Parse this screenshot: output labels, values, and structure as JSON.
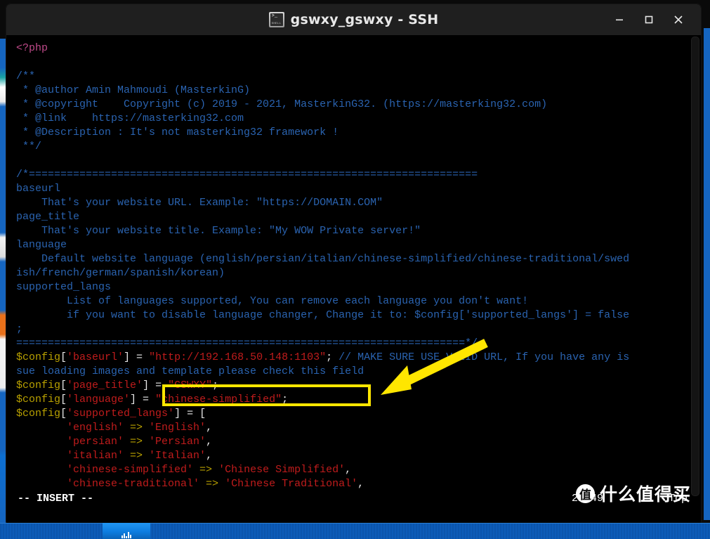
{
  "window": {
    "title": "gswxy_gswxy - SSH",
    "icon": "shell-terminal-icon",
    "icon_prompt": ">_",
    "icon_word": "SHELL",
    "minimize_label": "Minimize",
    "maximize_label": "Maximize",
    "close_label": "Close"
  },
  "editor": {
    "lines": [
      {
        "id": 1,
        "segments": [
          {
            "t": "<?php",
            "c": "tag"
          }
        ]
      },
      {
        "id": 2,
        "segments": [
          {
            "t": "",
            "c": "cm"
          }
        ]
      },
      {
        "id": 3,
        "segments": [
          {
            "t": "/**",
            "c": "cm"
          }
        ]
      },
      {
        "id": 4,
        "segments": [
          {
            "t": " * @author Amin Mahmoudi (MasterkinG)",
            "c": "cm"
          }
        ]
      },
      {
        "id": 5,
        "segments": [
          {
            "t": " * @copyright    Copyright (c) 2019 - 2021, MasterkinG32. (https://masterking32.com)",
            "c": "cm"
          }
        ]
      },
      {
        "id": 6,
        "segments": [
          {
            "t": " * @link    https://masterking32.com",
            "c": "cm"
          }
        ]
      },
      {
        "id": 7,
        "segments": [
          {
            "t": " * @Description : It's not masterking32 framework !",
            "c": "cm"
          }
        ]
      },
      {
        "id": 8,
        "segments": [
          {
            "t": " **/",
            "c": "cm"
          }
        ]
      },
      {
        "id": 9,
        "segments": [
          {
            "t": "",
            "c": "cm"
          }
        ]
      },
      {
        "id": 10,
        "segments": [
          {
            "t": "/*=======================================================================",
            "c": "cm"
          }
        ]
      },
      {
        "id": 11,
        "segments": [
          {
            "t": "baseurl",
            "c": "cm"
          }
        ]
      },
      {
        "id": 12,
        "segments": [
          {
            "t": "    That's your website URL. Example: \"https://DOMAIN.COM\"",
            "c": "cm"
          }
        ]
      },
      {
        "id": 13,
        "segments": [
          {
            "t": "page_title",
            "c": "cm"
          }
        ]
      },
      {
        "id": 14,
        "segments": [
          {
            "t": "    That's your website title. Example: \"My WOW Private server!\"",
            "c": "cm"
          }
        ]
      },
      {
        "id": 15,
        "segments": [
          {
            "t": "language",
            "c": "cm"
          }
        ]
      },
      {
        "id": 16,
        "segments": [
          {
            "t": "    Default website language (english/persian/italian/chinese-simplified/chinese-traditional/swed",
            "c": "cm"
          }
        ]
      },
      {
        "id": 17,
        "segments": [
          {
            "t": "ish/french/german/spanish/korean)",
            "c": "cm"
          }
        ]
      },
      {
        "id": 18,
        "segments": [
          {
            "t": "supported_langs",
            "c": "cm"
          }
        ]
      },
      {
        "id": 19,
        "segments": [
          {
            "t": "        List of languages supported, You can remove each language you don't want!",
            "c": "cm"
          }
        ]
      },
      {
        "id": 20,
        "segments": [
          {
            "t": "        if you want to disable language changer, Change it to: $config['supported_langs'] = false",
            "c": "cm"
          }
        ]
      },
      {
        "id": 21,
        "segments": [
          {
            "t": ";",
            "c": "cm"
          }
        ]
      },
      {
        "id": 22,
        "segments": [
          {
            "t": "=======================================================================*/",
            "c": "cm"
          }
        ]
      },
      {
        "id": 23,
        "segments": [
          {
            "t": "$config",
            "c": "var"
          },
          {
            "t": "[",
            "c": "pun"
          },
          {
            "t": "'baseurl'",
            "c": "str"
          },
          {
            "t": "] = ",
            "c": "pun"
          },
          {
            "t": "\"http://192.168.50.148:1103\"",
            "c": "str"
          },
          {
            "t": ";",
            "c": "pun"
          },
          {
            "t": " // MAKE SURE USE VALID URL, If you have any is",
            "c": "cm"
          }
        ]
      },
      {
        "id": 24,
        "segments": [
          {
            "t": "sue loading images and template please check this field",
            "c": "cm"
          }
        ]
      },
      {
        "id": 25,
        "segments": [
          {
            "t": "$config",
            "c": "var"
          },
          {
            "t": "[",
            "c": "pun"
          },
          {
            "t": "'page_title'",
            "c": "str"
          },
          {
            "t": "] = ",
            "c": "pun"
          },
          {
            "t": "\"GSWXY\"",
            "c": "str"
          },
          {
            "t": ";",
            "c": "pun"
          }
        ]
      },
      {
        "id": 26,
        "segments": [
          {
            "t": "$config",
            "c": "var"
          },
          {
            "t": "[",
            "c": "pun"
          },
          {
            "t": "'language'",
            "c": "str"
          },
          {
            "t": "] = ",
            "c": "pun"
          },
          {
            "t": "\"chinese-simplified\"",
            "c": "str"
          },
          {
            "t": ";",
            "c": "pun"
          }
        ]
      },
      {
        "id": 27,
        "segments": [
          {
            "t": "$config",
            "c": "var"
          },
          {
            "t": "[",
            "c": "pun"
          },
          {
            "t": "'supported_langs'",
            "c": "str"
          },
          {
            "t": "] = [",
            "c": "pun"
          }
        ]
      },
      {
        "id": 28,
        "segments": [
          {
            "t": "        ",
            "c": "pun"
          },
          {
            "t": "'english'",
            "c": "str"
          },
          {
            "t": " => ",
            "c": "arr"
          },
          {
            "t": "'English'",
            "c": "str"
          },
          {
            "t": ",",
            "c": "pun"
          }
        ]
      },
      {
        "id": 29,
        "segments": [
          {
            "t": "        ",
            "c": "pun"
          },
          {
            "t": "'persian'",
            "c": "str"
          },
          {
            "t": " => ",
            "c": "arr"
          },
          {
            "t": "'Persian'",
            "c": "str"
          },
          {
            "t": ",",
            "c": "pun"
          }
        ]
      },
      {
        "id": 30,
        "segments": [
          {
            "t": "        ",
            "c": "pun"
          },
          {
            "t": "'italian'",
            "c": "str"
          },
          {
            "t": " => ",
            "c": "arr"
          },
          {
            "t": "'Italian'",
            "c": "str"
          },
          {
            "t": ",",
            "c": "pun"
          }
        ]
      },
      {
        "id": 31,
        "segments": [
          {
            "t": "        ",
            "c": "pun"
          },
          {
            "t": "'chinese-simplified'",
            "c": "str"
          },
          {
            "t": " => ",
            "c": "arr"
          },
          {
            "t": "'Chinese Simplified'",
            "c": "str"
          },
          {
            "t": ",",
            "c": "pun"
          }
        ]
      },
      {
        "id": 32,
        "segments": [
          {
            "t": "        ",
            "c": "pun"
          },
          {
            "t": "'chinese-traditional'",
            "c": "str"
          },
          {
            "t": " => ",
            "c": "arr"
          },
          {
            "t": "'Chinese Traditional'",
            "c": "str"
          },
          {
            "t": ",",
            "c": "pun"
          }
        ]
      }
    ]
  },
  "status": {
    "mode": "-- INSERT --",
    "position": "21,49",
    "scroll": "Top"
  },
  "annotation": {
    "highlight_value": "\"http://192.168.50.148:1103\";",
    "highlight_color": "#ffe600",
    "arrow_color": "#ffe600"
  },
  "watermark": {
    "badge": "值",
    "text": "什么值得买"
  },
  "colors": {
    "terminal_bg": "#000000",
    "comment": "#2a63b0",
    "variable": "#b8a000",
    "string": "#c01c1c",
    "punctuation": "#e8e8e8",
    "php_tag": "#c04a8a",
    "titlebar": "#1f1f1f",
    "taskbar": "#0b55ad"
  }
}
